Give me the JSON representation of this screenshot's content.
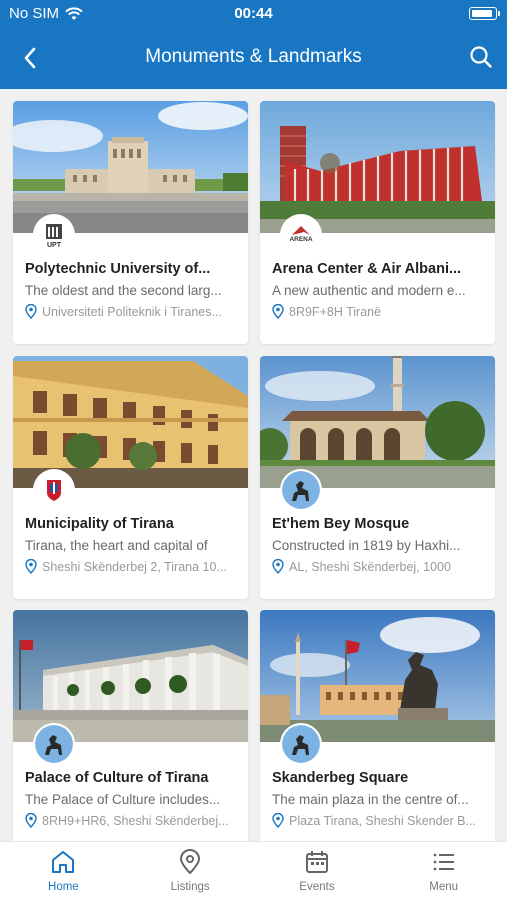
{
  "status_bar": {
    "carrier": "No SIM",
    "time": "00:44",
    "battery_level": 0.95
  },
  "nav": {
    "title": "Monuments & Landmarks"
  },
  "cards": [
    {
      "title": "Polytechnic University of...",
      "description": "The oldest and the second larg...",
      "address": "Universiteti Politeknik i Tiranes...",
      "logo_text": "UPT"
    },
    {
      "title": "Arena Center & Air Albani...",
      "description": "A new authentic and modern e...",
      "address": "8R9F+8H Tiranë",
      "logo_text": "ARENA"
    },
    {
      "title": "Municipality of Tirana",
      "description": "Tirana, the heart and capital of",
      "address": "Sheshi Skënderbej 2, Tirana 10..."
    },
    {
      "title": "Et'hem Bey Mosque",
      "description": "Constructed in 1819 by Haxhi...",
      "address": "AL, Sheshi Skënderbej, 1000"
    },
    {
      "title": "Palace of Culture of Tirana",
      "description": "The Palace of Culture includes...",
      "address": "8RH9+HR6, Sheshi Skënderbej..."
    },
    {
      "title": "Skanderbeg Square",
      "description": "The main plaza in the centre of...",
      "address": "Plaza Tirana, Sheshi Skender B..."
    }
  ],
  "tabs": [
    {
      "label": "Home",
      "icon": "home-icon",
      "active": true
    },
    {
      "label": "Listings",
      "icon": "location-pin-icon",
      "active": false
    },
    {
      "label": "Events",
      "icon": "calendar-icon",
      "active": false
    },
    {
      "label": "Menu",
      "icon": "menu-icon",
      "active": false
    }
  ],
  "colors": {
    "primary": "#1876c2",
    "background": "#f0f0f0"
  }
}
